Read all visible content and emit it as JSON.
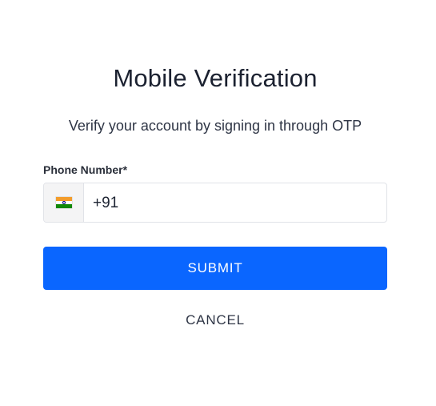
{
  "dialog": {
    "title": "Mobile Verification",
    "subtitle": "Verify your account by signing in through OTP"
  },
  "phone": {
    "label": "Phone Number*",
    "country_flag": "india-flag-icon",
    "value": "+91"
  },
  "actions": {
    "submit_label": "SUBMIT",
    "cancel_label": "CANCEL"
  },
  "colors": {
    "accent": "#0a66ff",
    "flag_box_bg": "#f4f4f5",
    "border": "#e1e3e8"
  }
}
